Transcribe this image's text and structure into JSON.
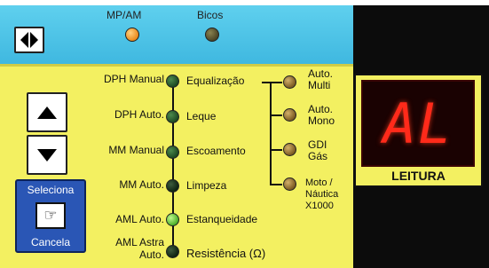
{
  "colors": {
    "panel_yellow": "#f3f061",
    "top_blue": "#3fb8e0",
    "background_black": "#0c0c0c",
    "select_blue": "#2a56b5",
    "display_red": "#ff2a1a"
  },
  "top_bar": {
    "mp_am_label": "MP/AM",
    "bicos_label": "Bicos"
  },
  "left_labels": [
    "DPH Manual",
    "DPH Auto.",
    "MM Manual",
    "MM Auto.",
    "AML Auto.",
    "AML Astra",
    "Auto."
  ],
  "mode_labels": [
    "Equalização",
    "Leque",
    "Escoamento",
    "Limpeza",
    "Estanqueidade",
    "Resistência (Ω)"
  ],
  "right_options": [
    {
      "line1": "Auto.",
      "line2": "Multi"
    },
    {
      "line1": "Auto.",
      "line2": "Mono"
    },
    {
      "line1": "GDI",
      "line2": "Gás"
    },
    {
      "line1": "Moto /",
      "line2": "Náutica",
      "line3": "X1000"
    }
  ],
  "select_button": {
    "top": "Seleciona",
    "bottom": "Cancela",
    "icon": "pointing-hand-icon"
  },
  "display": {
    "value": "AL",
    "caption": "LEITURA"
  },
  "icons": {
    "left_right": "left-right-arrows-icon",
    "up": "arrow-up-icon",
    "down": "arrow-down-icon"
  }
}
